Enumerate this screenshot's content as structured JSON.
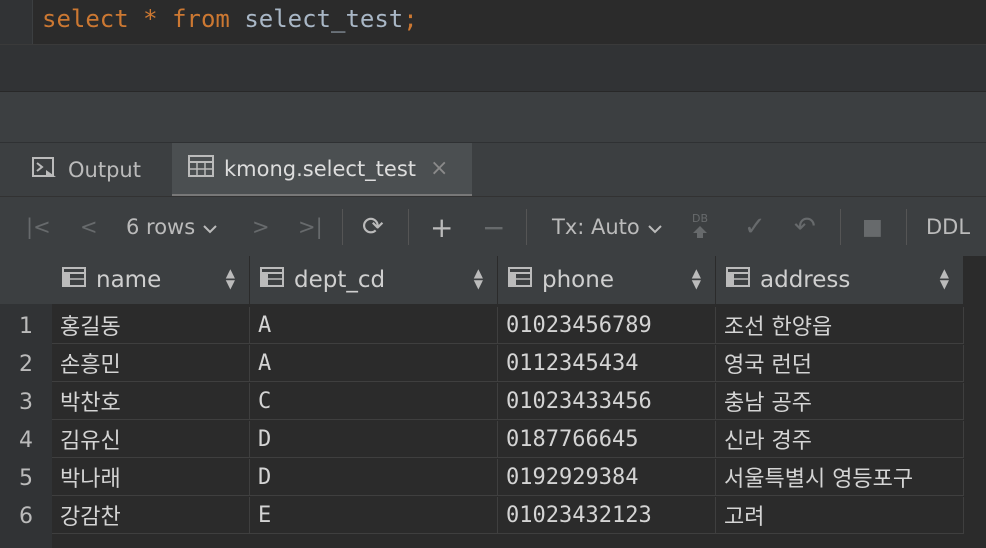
{
  "editor": {
    "kw_select": "select",
    "star": "*",
    "kw_from": "from",
    "table": "select_test",
    "semicolon": ";"
  },
  "tabs": {
    "output_label": "Output",
    "active_label": "kmong.select_test",
    "close": "×"
  },
  "toolbar": {
    "first": "|<",
    "prev": "<",
    "rows_label": "6 rows",
    "next": ">",
    "last": ">|",
    "refresh": "⟳",
    "add": "+",
    "remove": "−",
    "tx_label": "Tx: Auto",
    "db_label": "DB",
    "commit": "✓",
    "rollback": "↶",
    "stop": "■",
    "ddl_label": "DDL"
  },
  "grid": {
    "columns": [
      "name",
      "dept_cd",
      "phone",
      "address"
    ],
    "rows": [
      [
        "홍길동",
        "A",
        "01023456789",
        "조선 한양읍"
      ],
      [
        "손흥민",
        "A",
        "0112345434",
        "영국 런던"
      ],
      [
        "박찬호",
        "C",
        "01023433456",
        "충남 공주"
      ],
      [
        "김유신",
        "D",
        "0187766645",
        "신라 경주"
      ],
      [
        "박나래",
        "D",
        "0192929384",
        "서울특별시 영등포구"
      ],
      [
        "강감찬",
        "E",
        "01023432123",
        "고려"
      ]
    ],
    "row_numbers": [
      "1",
      "2",
      "3",
      "4",
      "5",
      "6"
    ]
  },
  "colors": {
    "keyword": "#cc7832",
    "identifier": "#a9b7c6",
    "background": "#2b2b2b",
    "panel": "#3c3f41"
  }
}
